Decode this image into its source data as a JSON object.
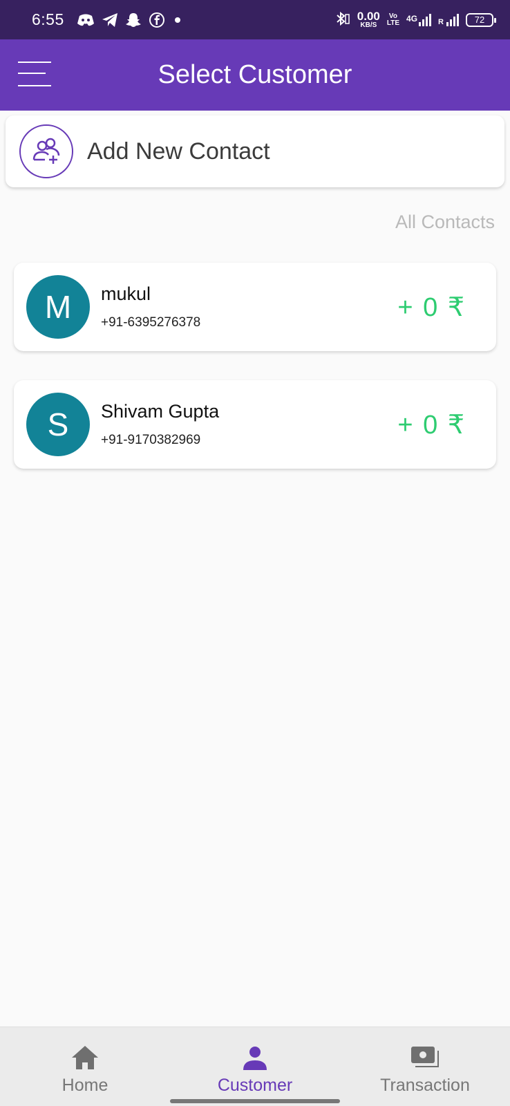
{
  "status_bar": {
    "time": "6:55",
    "net_speed_value": "0.00",
    "net_speed_unit": "KB/S",
    "volte_top": "Vo",
    "volte_bottom": "LTE",
    "network_type": "4G",
    "roaming": "R",
    "battery": "72",
    "left_icons": [
      "discord-icon",
      "telegram-icon",
      "snapchat-icon",
      "facebook-icon",
      "notification-dot-icon"
    ],
    "right_icons": [
      "bluetooth-icon",
      "signal-icon",
      "signal-icon"
    ]
  },
  "app_bar": {
    "title": "Select Customer",
    "menu_icon": "menu-icon"
  },
  "add_contact": {
    "label": "Add New Contact",
    "icon": "add-user-icon"
  },
  "section_label": "All Contacts",
  "contacts": [
    {
      "initial": "M",
      "name": "mukul",
      "phone": "+91-6395276378",
      "balance": "+ 0 ₹"
    },
    {
      "initial": "S",
      "name": "Shivam Gupta",
      "phone": "+91-9170382969",
      "balance": "+ 0 ₹"
    }
  ],
  "bottom_nav": {
    "items": [
      {
        "label": "Home",
        "icon": "home-icon",
        "active": false
      },
      {
        "label": "Customer",
        "icon": "person-icon",
        "active": true
      },
      {
        "label": "Transaction",
        "icon": "money-icon",
        "active": false
      }
    ]
  },
  "colors": {
    "status_bar": "#37215f",
    "primary": "#673ab7",
    "avatar": "#128397",
    "balance": "#2ecc71",
    "background": "#fafafa"
  }
}
